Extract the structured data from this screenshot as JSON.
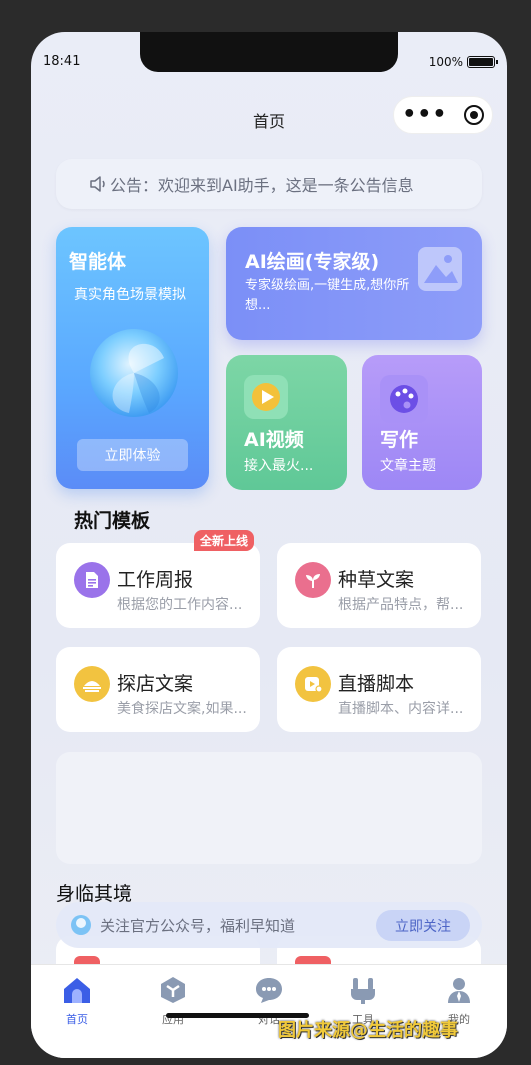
{
  "status": {
    "time": "18:41",
    "battery": "100%"
  },
  "nav": {
    "title": "首页"
  },
  "notice": {
    "text": "公告：欢迎来到AI助手，这是一条公告信息",
    "icon": "speaker-icon"
  },
  "cards": {
    "agent": {
      "title": "智能体",
      "subtitle": "真实角色场景模拟",
      "button": "立即体验"
    },
    "drawing": {
      "title": "AI绘画(专家级)",
      "subtitle": "专家级绘画,一键生成,想你所想..."
    },
    "video": {
      "title": "AI视频",
      "subtitle": "接入最火..."
    },
    "writing": {
      "title": "写作",
      "subtitle": "文章主题"
    }
  },
  "hot_templates": {
    "title": "热门模板",
    "badge": "全新上线",
    "items": [
      {
        "title": "工作周报",
        "desc": "根据您的工作内容...",
        "color": "#9a73ea",
        "icon": "document-icon"
      },
      {
        "title": "种草文案",
        "desc": "根据产品特点，帮...",
        "color": "#ea6f8e",
        "icon": "sprout-icon"
      },
      {
        "title": "探店文案",
        "desc": "美食探店文案,如果...",
        "color": "#f2c340",
        "icon": "store-icon"
      },
      {
        "title": "直播脚本",
        "desc": "直播脚本、内容详...",
        "color": "#f2c340",
        "icon": "live-play-icon"
      }
    ]
  },
  "immersive": {
    "title": "身临其境"
  },
  "follow": {
    "text": "关注官方公众号，福利早知道",
    "button": "立即关注"
  },
  "tabs": [
    {
      "label": "首页",
      "icon": "home-icon",
      "active": true
    },
    {
      "label": "应用",
      "icon": "cube-icon",
      "active": false
    },
    {
      "label": "对话",
      "icon": "chat-icon",
      "active": false
    },
    {
      "label": "工具",
      "icon": "tools-icon",
      "active": false
    },
    {
      "label": "我的",
      "icon": "user-icon",
      "active": false
    }
  ],
  "watermark": "图片来源@生活的趣事",
  "colors": {
    "accent": "#3b5ee6",
    "badge": "#ef6063",
    "watermark": "#f0c93a"
  }
}
